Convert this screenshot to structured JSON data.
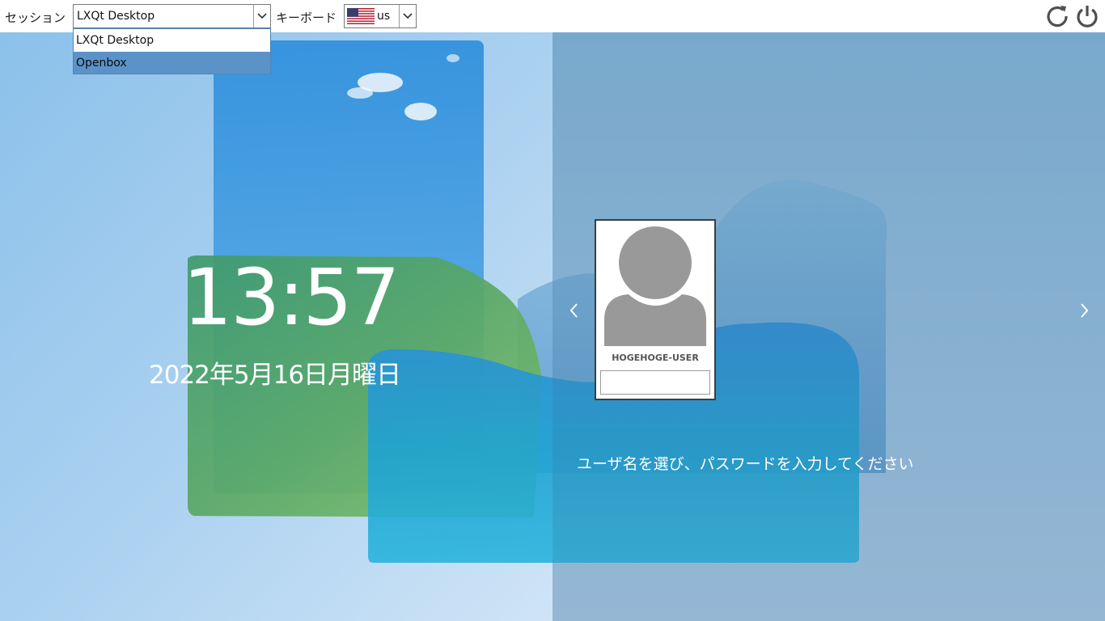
{
  "topbar": {
    "session_label": "セッション",
    "session_value": "LXQt Desktop",
    "keyboard_label": "キーボード",
    "keyboard_value": "us"
  },
  "session_dropdown": {
    "options": [
      "LXQt Desktop",
      "Openbox"
    ],
    "highlighted": "Openbox"
  },
  "clock": {
    "time": "13:57",
    "date": "2022年5月16日月曜日"
  },
  "user": {
    "name": "HOGEHOGE-USER",
    "password_value": ""
  },
  "prompt": "ユーザ名を選び、パスワードを入力してください",
  "icons": {
    "restart": "restart-icon",
    "shutdown": "power-icon",
    "prev": "chevron-left-icon",
    "next": "chevron-right-icon"
  },
  "colors": {
    "selection": "#5b93c8",
    "wallpaper_sky": "#9cc6e8"
  }
}
